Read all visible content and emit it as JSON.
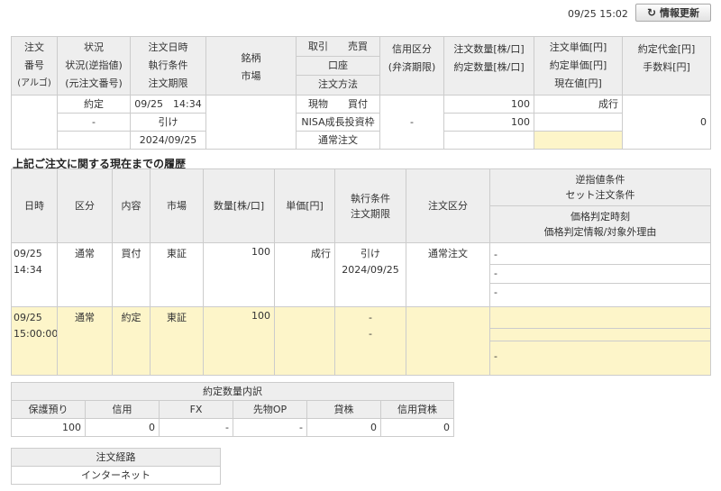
{
  "header": {
    "timestamp": "09/25 15:02",
    "refresh_label": "情報更新"
  },
  "order": {
    "headers": {
      "col1": [
        "注文",
        "番号",
        "(アルゴ)"
      ],
      "col2": [
        "状況",
        "状況(逆指値)",
        "(元注文番号)"
      ],
      "col3": [
        "注文日時",
        "執行条件",
        "注文期限"
      ],
      "col4": [
        "銘柄",
        "市場"
      ],
      "col5": [
        "取引　　売買",
        "口座",
        "注文方法"
      ],
      "col6": [
        "信用区分",
        "(弁済期限)"
      ],
      "col7": [
        "注文数量[株/口]",
        "約定数量[株/口]"
      ],
      "col8": [
        "注文単価[円]",
        "約定単価[円]",
        "現在値[円]"
      ],
      "col9": [
        "約定代金[円]",
        "手数料[円]"
      ]
    },
    "row": {
      "number": "",
      "status": "約定",
      "status_stop": "-",
      "order_datetime": "09/25　14:34",
      "exec_condition": "引け",
      "expiry": "2024/09/25",
      "symbol": "",
      "trade_side": "現物　　買付",
      "account": "NISA成長投資枠",
      "order_method": "通常注文",
      "credit_type": "-",
      "order_qty": "100",
      "exec_qty": "100",
      "order_price": "成行",
      "exec_price": "",
      "current_price": "",
      "exec_amount": "",
      "fee": "0"
    }
  },
  "history": {
    "title": "上記ご注文に関する現在までの履歴",
    "headers": {
      "date": "日時",
      "kubun": "区分",
      "content": "内容",
      "market": "市場",
      "qty": "数量[株/口]",
      "price": "単価[円]",
      "exec_cond": "執行条件",
      "expiry": "注文期限",
      "order_type": "注文区分",
      "stop_cond": "逆指値条件",
      "set_cond": "セット注文条件",
      "price_time": "価格判定時刻",
      "price_info": "価格判定情報/対象外理由"
    },
    "rows": [
      {
        "date": "09/25",
        "time": "14:34",
        "kubun": "通常",
        "content": "買付",
        "market": "東証",
        "qty": "100",
        "price": "成行",
        "exec_cond": "引け",
        "expiry": "2024/09/25",
        "order_type": "通常注文",
        "cond1": "-",
        "cond2": "-",
        "cond3": "-"
      },
      {
        "date": "09/25",
        "time": "15:00:00",
        "kubun": "通常",
        "content": "約定",
        "market": "東証",
        "qty": "100",
        "price": "",
        "exec_cond": "-",
        "expiry": "-",
        "order_type": "",
        "cond1": "",
        "cond2": "",
        "cond3": "-"
      }
    ]
  },
  "breakdown": {
    "title": "約定数量内訳",
    "headers": [
      "保護預り",
      "信用",
      "FX",
      "先物OP",
      "貸株",
      "信用貸株"
    ],
    "values": [
      "100",
      "0",
      "-",
      "-",
      "0",
      "0"
    ]
  },
  "route": {
    "title": "注文経路",
    "value": "インターネット"
  }
}
